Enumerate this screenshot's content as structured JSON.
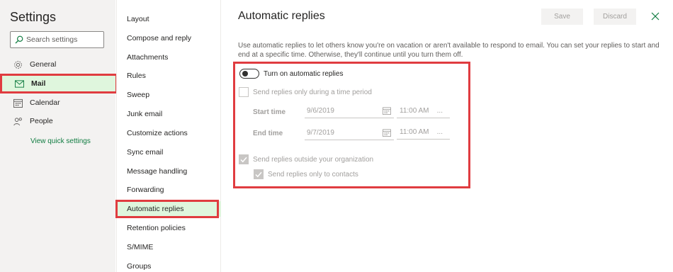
{
  "settings": {
    "title": "Settings",
    "search_placeholder": "Search settings",
    "nav": [
      {
        "label": "General",
        "icon": "gear-icon"
      },
      {
        "label": "Mail",
        "icon": "mail-icon"
      },
      {
        "label": "Calendar",
        "icon": "calendar-icon"
      },
      {
        "label": "People",
        "icon": "people-icon"
      }
    ],
    "quick_settings": "View quick settings"
  },
  "mail_sub": {
    "items": [
      {
        "label": "Layout"
      },
      {
        "label": "Compose and reply"
      },
      {
        "label": "Attachments"
      },
      {
        "label": "Rules"
      },
      {
        "label": "Sweep"
      },
      {
        "label": "Junk email"
      },
      {
        "label": "Customize actions"
      },
      {
        "label": "Sync email"
      },
      {
        "label": "Message handling"
      },
      {
        "label": "Forwarding"
      },
      {
        "label": "Automatic replies"
      },
      {
        "label": "Retention policies"
      },
      {
        "label": "S/MIME"
      },
      {
        "label": "Groups"
      }
    ],
    "active": "Automatic replies"
  },
  "main": {
    "title": "Automatic replies",
    "save_label": "Save",
    "discard_label": "Discard",
    "description": "Use automatic replies to let others know you're on vacation or aren't available to respond to email. You can set your replies to start and end at a specific time. Otherwise, they'll continue until you turn them off.",
    "toggle_label": "Turn on automatic replies",
    "time_period_label": "Send replies only during a time period",
    "start_time_label": "Start time",
    "start_date": "9/6/2019",
    "start_time": "11:00 AM",
    "end_time_label": "End time",
    "end_date": "9/7/2019",
    "end_time": "11:00 AM",
    "outside_org_label": "Send replies outside your organization",
    "contacts_only_label": "Send replies only to contacts",
    "ellipsis": "..."
  },
  "colors": {
    "accent_green": "#107c41",
    "active_bg": "#dff6dd",
    "highlight_red": "#e03c40"
  }
}
